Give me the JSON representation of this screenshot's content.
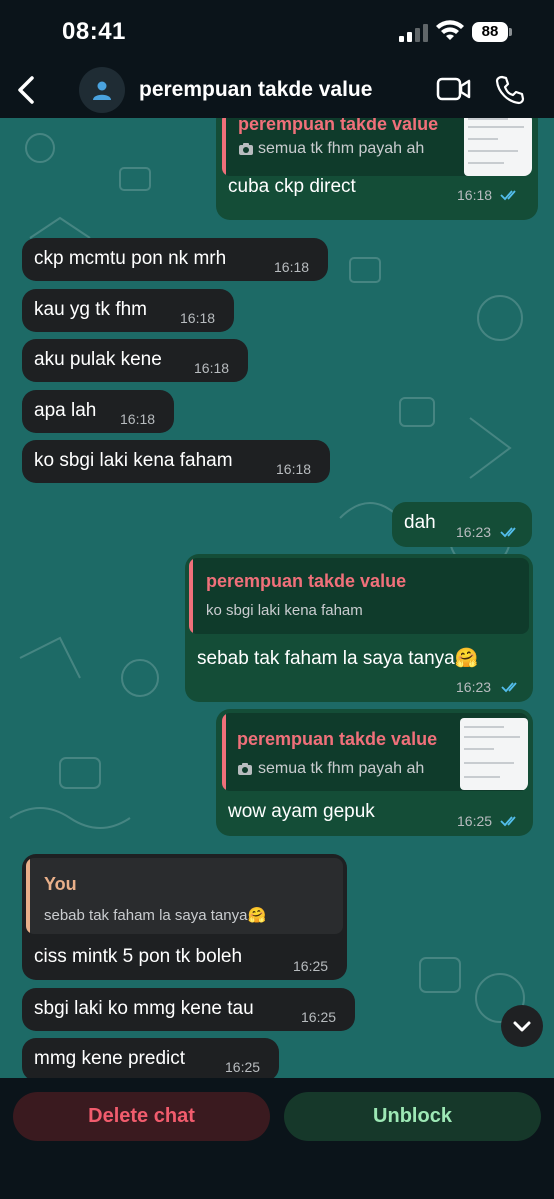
{
  "status_bar": {
    "time": "08:41",
    "battery": "88"
  },
  "header": {
    "contact_name": "perempuan takde value"
  },
  "messages": [
    {
      "text": "cuba ckp direct",
      "time": "16:18",
      "quote_author": "perempuan takde value",
      "quote_text": "semua tk fhm payah ah"
    },
    {
      "text": "ckp mcmtu pon nk mrh",
      "time": "16:18"
    },
    {
      "text": "kau yg tk fhm",
      "time": "16:18"
    },
    {
      "text": "aku pulak kene",
      "time": "16:18"
    },
    {
      "text": "apa lah",
      "time": "16:18"
    },
    {
      "text": "ko sbgi laki kena faham",
      "time": "16:18"
    },
    {
      "text": "dah",
      "time": "16:23"
    },
    {
      "text": "sebab tak faham la saya tanya🤗",
      "time": "16:23",
      "quote_author": "perempuan takde value",
      "quote_text": "ko sbgi laki kena faham"
    },
    {
      "text": "wow ayam gepuk",
      "time": "16:25",
      "quote_author": "perempuan takde value",
      "quote_text": "semua tk fhm payah ah"
    },
    {
      "text": "ciss mintk 5 pon tk boleh",
      "time": "16:25",
      "quote_author": "You",
      "quote_text": "sebab tak faham la saya tanya🤗"
    },
    {
      "text": "sbgi laki ko mmg kene tau",
      "time": "16:25"
    },
    {
      "text": "mmg kene predict",
      "time": "16:25"
    }
  ],
  "actions": {
    "delete_label": "Delete chat",
    "unblock_label": "Unblock"
  },
  "colors": {
    "quote_author_out": "#f0707a",
    "quote_author_in": "#e9b08a",
    "tick_blue": "#53bdeb"
  },
  "icons": [
    "back-icon",
    "person-icon",
    "video-call-icon",
    "phone-icon",
    "camera-icon",
    "chevron-down-icon"
  ]
}
